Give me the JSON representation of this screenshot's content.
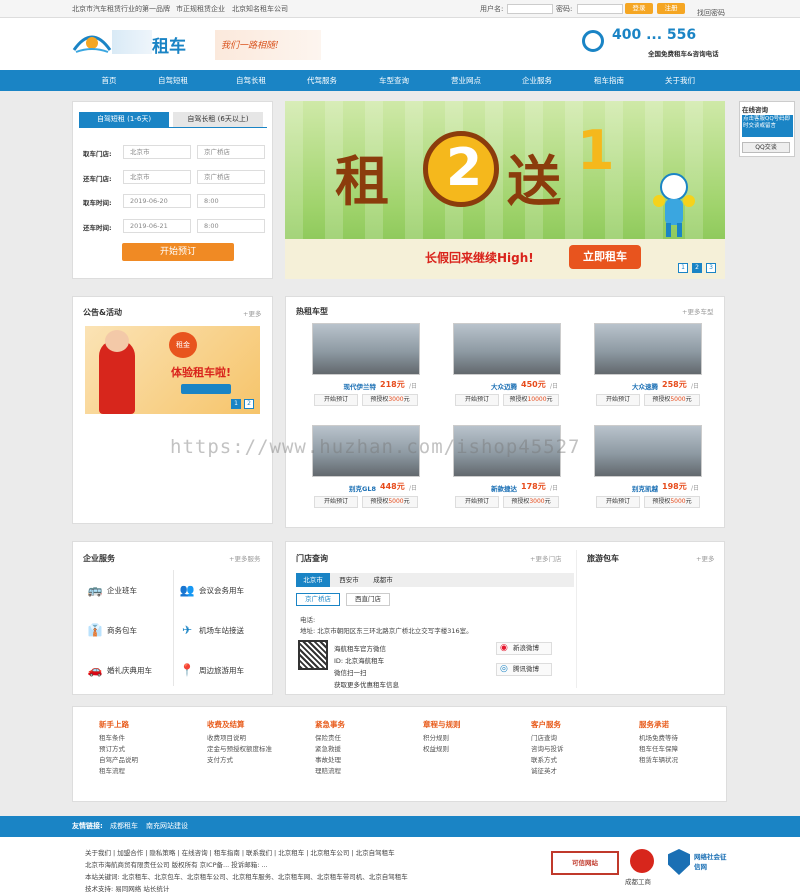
{
  "topbar": {
    "links": [
      "北京市汽车租赁行业的第一品牌",
      "市正规租赁企业",
      "北京知名租车公司"
    ],
    "username_label": "用户名:",
    "password_label": "密码:",
    "login_button": "登录",
    "register_button": "注册",
    "forgot_password": "找回密码"
  },
  "header": {
    "logo_text": "租车",
    "slogan": "我们一路相随!",
    "phone_display": "400 ... 556",
    "phone_caption": "全国免费租车&咨询电话"
  },
  "nav": [
    "首页",
    "自驾短租",
    "自驾长租",
    "代驾服务",
    "车型查询",
    "营业网点",
    "企业服务",
    "租车指南",
    "关于我们"
  ],
  "booking": {
    "tab_short": "自驾短租 (1-6天)",
    "tab_long": "自驾长租 (6天以上)",
    "pickup_store_label": "取车门店:",
    "return_store_label": "还车门店:",
    "pickup_time_label": "取车时间:",
    "return_time_label": "还车时间:",
    "pickup_city": "北京市",
    "pickup_store": "京广桥店",
    "return_city": "北京市",
    "return_store": "京广桥店",
    "pickup_date": "2019-06-20",
    "pickup_hour": "8:00",
    "return_date": "2019-06-21",
    "return_hour": "8:00",
    "submit": "开始预订"
  },
  "banner": {
    "title_chars": [
      "租",
      "2",
      "送",
      "1"
    ],
    "subtitle": "长假回来继续High!",
    "cta": "立即租车",
    "pages": [
      "1",
      "2",
      "3"
    ]
  },
  "online_consult": {
    "title": "在线咨询",
    "text": "点击客服QQ号码即时交谈或留言",
    "qq_label": "QQ交谈"
  },
  "notice": {
    "title": "公告&活动",
    "more": "+更多",
    "promo_text": "体验租车啦!",
    "promo_badge": "租金",
    "pages": [
      "1",
      "2"
    ]
  },
  "hot_cars": {
    "title": "热租车型",
    "more": "+更多车型",
    "per_day": "/日",
    "book_label": "开始预订",
    "deposit_prefix": "预授权",
    "deposit_suffix": "元",
    "cars": [
      {
        "name": "现代伊兰特",
        "price": "218元",
        "deposit": "3000"
      },
      {
        "name": "大众迈腾",
        "price": "450元",
        "deposit": "10000"
      },
      {
        "name": "大众速腾",
        "price": "258元",
        "deposit": "5000"
      },
      {
        "name": "别克GL8",
        "price": "448元",
        "deposit": "5000"
      },
      {
        "name": "新款捷达",
        "price": "178元",
        "deposit": "3000"
      },
      {
        "name": "别克凯越",
        "price": "198元",
        "deposit": "5000"
      }
    ]
  },
  "enterprise": {
    "title": "企业服务",
    "more": "+更多服务",
    "items": [
      {
        "label": "企业班车",
        "icon": "bus-icon",
        "glyph": "🚌"
      },
      {
        "label": "会议会务用车",
        "icon": "meeting-icon",
        "glyph": "👥"
      },
      {
        "label": "商务包车",
        "icon": "business-icon",
        "glyph": "👔"
      },
      {
        "label": "机场车站接送",
        "icon": "plane-icon",
        "glyph": "✈"
      },
      {
        "label": "婚礼庆典用车",
        "icon": "wedding-car-icon",
        "glyph": "🚗"
      },
      {
        "label": "周边旅游用车",
        "icon": "location-pin-icon",
        "glyph": "📍"
      }
    ]
  },
  "stores": {
    "title": "门店查询",
    "more": "+更多门店",
    "cities": [
      "北京市",
      "西安市",
      "成都市"
    ],
    "branches": [
      "京广桥店",
      "西直门店"
    ],
    "phone_label": "电话:",
    "address": "地址: 北京市朝阳区东三环北路京广桥北立交写字楼316室。",
    "wechat_lines": [
      "海航租车官方微信",
      "ID: 北京海航租车",
      "微信扫一扫",
      "获取更多优惠租车信息"
    ],
    "sina_weibo": "新浪微博",
    "tencent_weibo": "腾讯微博"
  },
  "tour": {
    "title": "旅游包车",
    "more": "+更多"
  },
  "footer_links": [
    {
      "head": "新手上路",
      "items": [
        "租车条件",
        "预订方式",
        "自驾产品说明",
        "租车流程"
      ]
    },
    {
      "head": "收费及结算",
      "items": [
        "收费项目说明",
        "定金与预授权额度标准",
        "支付方式"
      ]
    },
    {
      "head": "紧急事务",
      "items": [
        "保险责任",
        "紧急救援",
        "事故处理",
        "理赔流程"
      ]
    },
    {
      "head": "章程与规则",
      "items": [
        "积分规则",
        "权益规则"
      ]
    },
    {
      "head": "客户服务",
      "items": [
        "门店查询",
        "咨询与投诉",
        "联系方式",
        "诚征英才"
      ]
    },
    {
      "head": "服务承诺",
      "items": [
        "机场免费等待",
        "租车任车保障",
        "租赁车辆状况"
      ]
    }
  ],
  "friend_links": {
    "label": "友情链接:",
    "items": [
      "成都租车",
      "南充网站建设"
    ]
  },
  "bottom": {
    "links": [
      "关于我们",
      "加盟合作",
      "隐私策略",
      "在线咨询",
      "租车指南",
      "联系我们",
      "北京租车",
      "北京租车公司",
      "北京自驾租车"
    ],
    "copyright": "北京市海航商贸有限责任公司 版权所有  京ICP备... 投诉邮箱: ...",
    "keywords": "本站关键词: 北京租车、北京包车、北京租车公司、北京租车服务、北京租车网、北京租车带司机、北京自驾租车",
    "tech": "技术支持: 易同网络  站长统计",
    "badges": [
      "可信网站",
      "成都工商",
      "网络社会征信网"
    ]
  },
  "watermark": "https://www.huzhan.com/ishop45527",
  "colors": {
    "brand_blue": "#1a84c5",
    "accent_orange": "#f08a24",
    "price_red": "#e74c1c"
  }
}
